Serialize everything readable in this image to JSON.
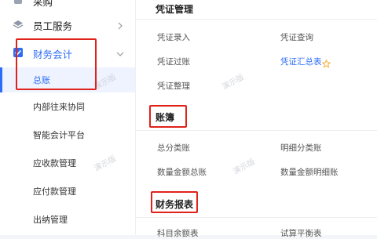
{
  "sidebar": {
    "top_cutoff_label": "采购",
    "items": [
      {
        "label": "员工服务"
      },
      {
        "label": "财务会计"
      }
    ],
    "sub_items": [
      {
        "label": "总账"
      },
      {
        "label": "内部往来协同"
      },
      {
        "label": "智能会计平台"
      },
      {
        "label": "应收款管理"
      },
      {
        "label": "应付款管理"
      },
      {
        "label": "出纳管理"
      }
    ],
    "watermark": "演示版"
  },
  "main": {
    "sections": [
      {
        "title": "凭证管理",
        "links": [
          "凭证录入",
          "凭证查询",
          "凭证过账",
          "凭证汇总表",
          "凭证整理"
        ]
      },
      {
        "title": "账簿",
        "links": [
          "总分类账",
          "明细分类账",
          "数量金额总账",
          "数量金额明细账"
        ]
      },
      {
        "title": "财务报表",
        "links": [
          "科目余额表",
          "试算平衡表"
        ]
      }
    ]
  },
  "colors": {
    "accent": "#2d6df6",
    "highlight_box": "#e0221b",
    "star": "#f5a623"
  }
}
